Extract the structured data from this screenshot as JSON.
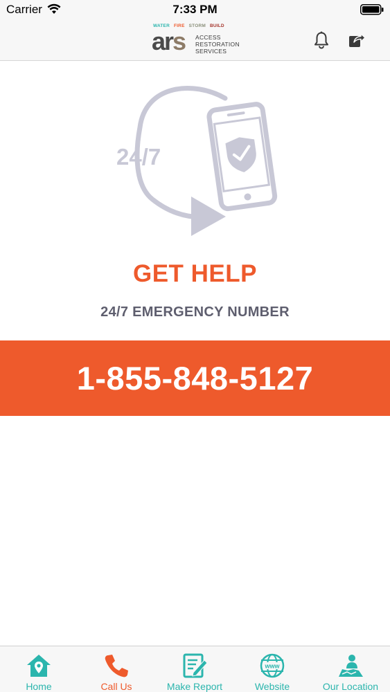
{
  "status_bar": {
    "carrier": "Carrier",
    "time": "7:33 PM"
  },
  "header": {
    "logo": {
      "tags": [
        "WATER",
        "FIRE",
        "STORM",
        "BUILD"
      ],
      "mark_a": "ar",
      "mark_s": "s",
      "line1": "ACCESS",
      "line2": "RESTORATION",
      "line3": "SERVICES"
    }
  },
  "hero": {
    "badge_text": "24/7"
  },
  "main": {
    "title": "GET HELP",
    "subtitle": "24/7 EMERGENCY NUMBER",
    "phone": "1-855-848-5127"
  },
  "tabs": [
    {
      "label": "Home",
      "icon": "home-pin-icon"
    },
    {
      "label": "Call Us",
      "icon": "phone-icon"
    },
    {
      "label": "Make Report",
      "icon": "report-pencil-icon"
    },
    {
      "label": "Website",
      "icon": "globe-www-icon"
    },
    {
      "label": "Our Location",
      "icon": "location-person-icon"
    }
  ],
  "colors": {
    "accent": "#ee5a2c",
    "teal": "#2bb5ad",
    "hero_grey": "#c8c8d6",
    "text_grey": "#5e5e6e"
  }
}
